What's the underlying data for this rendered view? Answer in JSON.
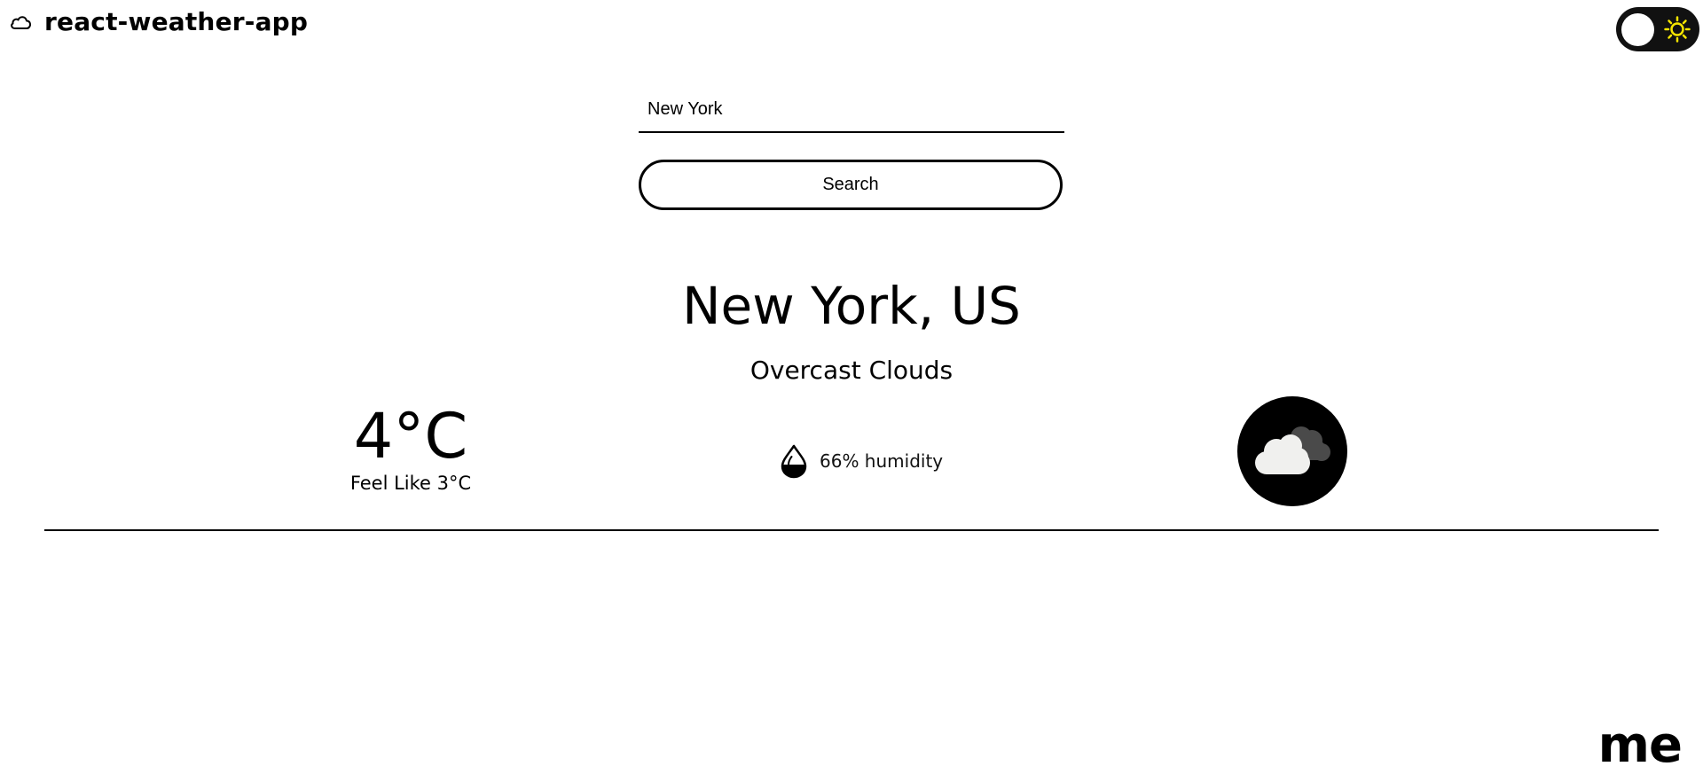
{
  "header": {
    "title": "react-weather-app",
    "logo_icon": "cloud-icon"
  },
  "theme_toggle": {
    "icon": "sun-icon",
    "state": "off",
    "icon_color": "#f5e500"
  },
  "search": {
    "value": "New York",
    "button_label": "Search"
  },
  "weather": {
    "location": "New York, US",
    "condition": "Overcast Clouds",
    "temperature": "4°C",
    "feels_like": "Feel Like 3°C",
    "humidity": "66% humidity",
    "humidity_icon": "water-drop-icon",
    "condition_icon": "overcast-clouds-icon"
  },
  "footer": {
    "mark": "me"
  },
  "colors": {
    "background": "#ffffff",
    "foreground": "#000000",
    "toggle_track": "#111111",
    "sun": "#f5e500"
  }
}
